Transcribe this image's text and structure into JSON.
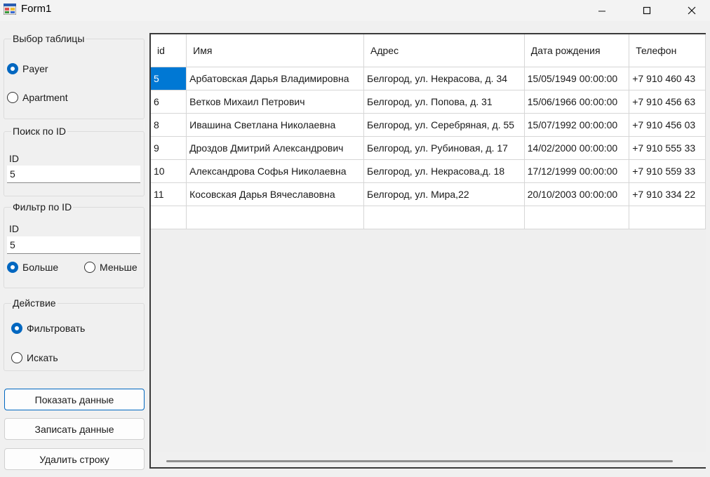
{
  "window": {
    "title": "Form1"
  },
  "table_select": {
    "title": "Выбор таблицы",
    "options": [
      {
        "label": "Payer",
        "checked": true
      },
      {
        "label": "Apartment",
        "checked": false
      }
    ]
  },
  "search_by_id": {
    "title": "Поиск по ID",
    "label": "ID",
    "value": "5"
  },
  "filter_by_id": {
    "title": "Фильтр по ID",
    "label": "ID",
    "value": "5",
    "options": [
      {
        "label": "Больше",
        "checked": true
      },
      {
        "label": "Меньше",
        "checked": false
      }
    ]
  },
  "action": {
    "title": "Действие",
    "options": [
      {
        "label": "Фильтровать",
        "checked": true
      },
      {
        "label": "Искать",
        "checked": false
      }
    ]
  },
  "buttons": {
    "show": "Показать данные",
    "write": "Записать данные",
    "delete": "Удалить строку"
  },
  "grid": {
    "columns": [
      "id",
      "Имя",
      "Адрес",
      "Дата рождения",
      "Телефон"
    ],
    "rows": [
      [
        "5",
        "Арбатовская Дарья Владимировна",
        "Белгород, ул. Некрасова, д. 34",
        "15/05/1949 00:00:00",
        "+7 910 460 43"
      ],
      [
        "6",
        "Ветков Михаил Петрович",
        "Белгород, ул. Попова, д. 31",
        "15/06/1966 00:00:00",
        "+7 910 456 63"
      ],
      [
        "8",
        "Ивашина Светлана Николаевна",
        "Белгород, ул. Серебряная, д. 55",
        "15/07/1992 00:00:00",
        "+7 910 456 03"
      ],
      [
        "9",
        "Дроздов Дмитрий Александрович",
        "Белгород, ул. Рубиновая, д. 17",
        "14/02/2000 00:00:00",
        "+7 910 555 33"
      ],
      [
        "10",
        "Александрова Софья Николаевна",
        "Белгород, ул. Некрасова,д. 18",
        "17/12/1999 00:00:00",
        "+7 910 559 33"
      ],
      [
        "11",
        "Косовская Дарья Вячеславовна",
        "Белгород, ул. Мира,22",
        "20/10/2003 00:00:00",
        "+7 910 334 22"
      ]
    ],
    "selected_cell": "5"
  },
  "colors": {
    "accent": "#0067c0",
    "selection": "#0078d4"
  }
}
